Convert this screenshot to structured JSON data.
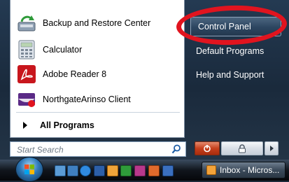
{
  "start_menu": {
    "programs": [
      {
        "label": "Backup and Restore Center",
        "icon": "backup-restore-icon"
      },
      {
        "label": "Calculator",
        "icon": "calculator-icon"
      },
      {
        "label": "Adobe Reader 8",
        "icon": "adobe-reader-icon"
      },
      {
        "label": "NorthgateArinso Client",
        "icon": "northgatearinso-icon"
      }
    ],
    "all_programs": "All Programs",
    "search_placeholder": "Start Search",
    "right_items": [
      {
        "label": "Control Panel",
        "highlighted": true
      },
      {
        "label": "Default Programs"
      },
      {
        "label": "Help and Support"
      }
    ]
  },
  "taskbar": {
    "window_button": "Inbox - Micros..."
  },
  "colors": {
    "annotation_ring": "#e1141f",
    "menu_background": "#1f3247",
    "taskbar": "#0b0f14"
  }
}
